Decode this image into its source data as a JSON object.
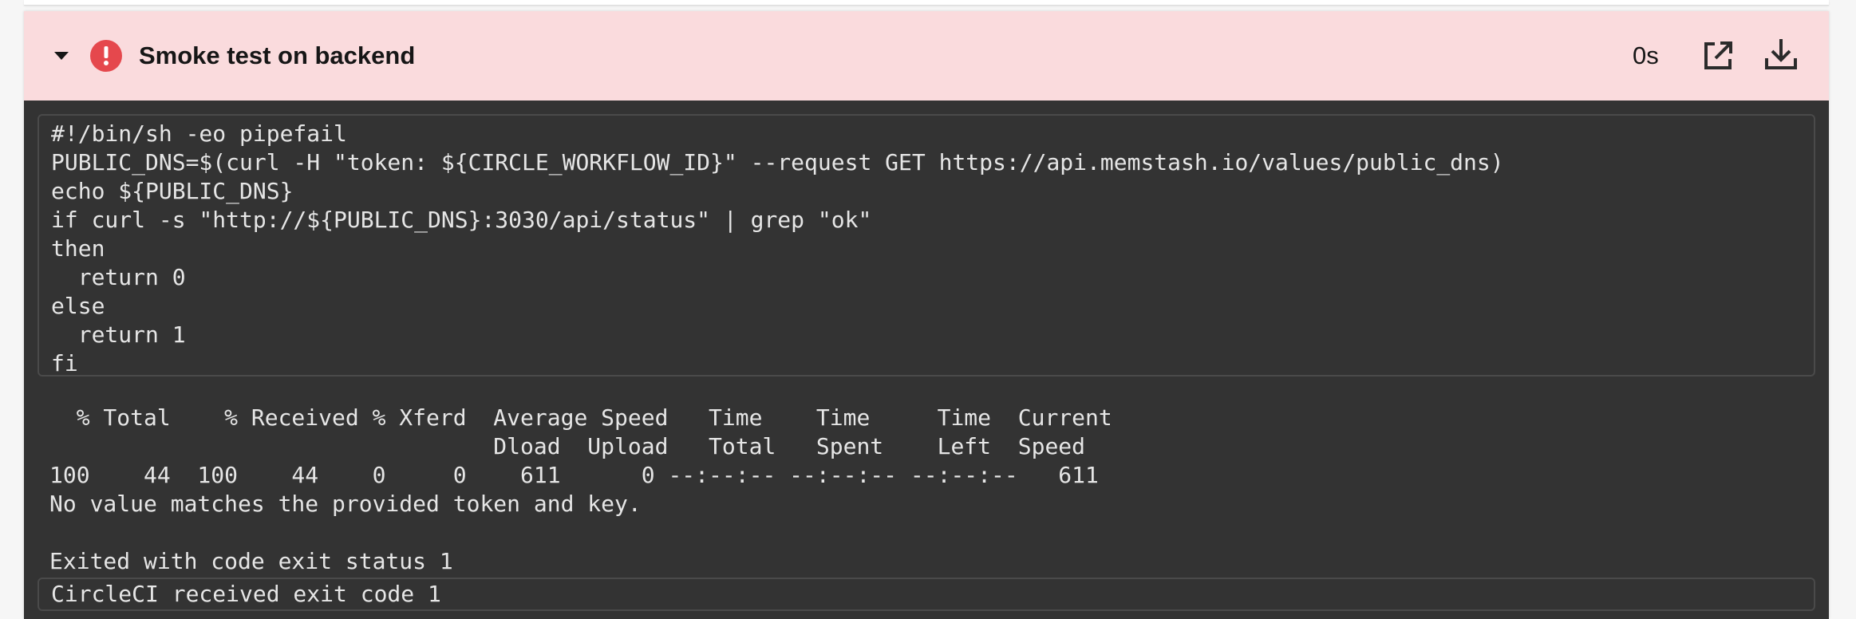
{
  "step": {
    "title": "Smoke test on backend",
    "duration": "0s",
    "status": "failed",
    "colors": {
      "header_bg": "#fadbdd",
      "status_red": "#e5484d",
      "console_bg": "#333333"
    },
    "icons": [
      "caret-down-icon",
      "error-status-icon",
      "open-external-icon",
      "download-icon"
    ]
  },
  "command": {
    "script": "#!/bin/sh -eo pipefail\nPUBLIC_DNS=$(curl -H \"token: ${CIRCLE_WORKFLOW_ID}\" --request GET https://api.memstash.io/values/public_dns)\necho ${PUBLIC_DNS}\nif curl -s \"http://${PUBLIC_DNS}:3030/api/status\" | grep \"ok\"\nthen\n  return 0\nelse\n  return 1\nfi"
  },
  "output": {
    "log": "  % Total    % Received % Xferd  Average Speed   Time    Time     Time  Current\n                                 Dload  Upload   Total   Spent    Left  Speed\n100    44  100    44    0     0    611      0 --:--:-- --:--:-- --:--:--   611\nNo value matches the provided token and key.\n\nExited with code exit status 1"
  },
  "exit": {
    "message": "CircleCI received exit code 1"
  }
}
